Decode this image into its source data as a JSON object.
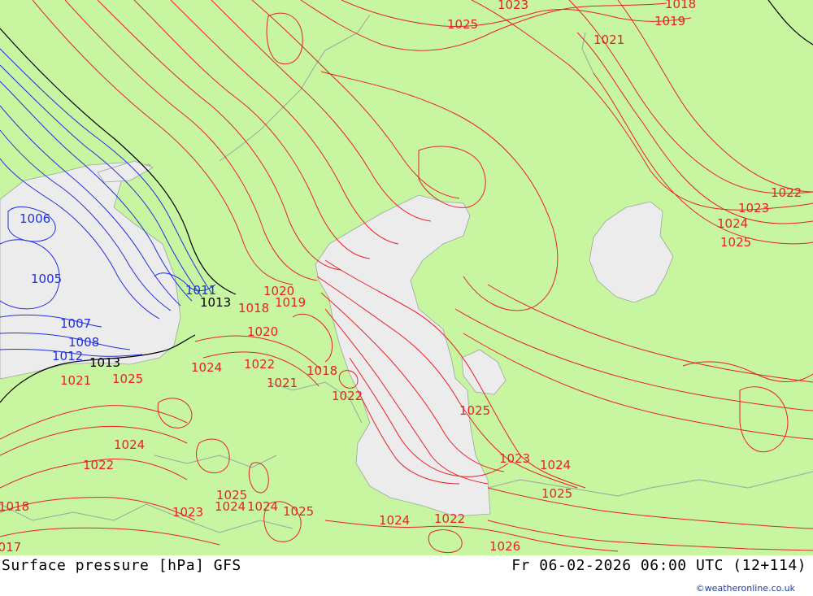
{
  "title": "Surface pressure [hPa] GFS",
  "valid_time": "Fr 06-02-2026 06:00 UTC (12+114)",
  "credit": "©weatheronline.co.uk",
  "colors": {
    "land": "#c8f5a0",
    "water": "#ececec",
    "high_isobar": "#e8202a",
    "low_isobar": "#2030e0",
    "ref_isobar": "#000000"
  },
  "isobar_labels": [
    {
      "text": "1023",
      "kind": "high"
    },
    {
      "text": "1018",
      "kind": "high"
    },
    {
      "text": "1019",
      "kind": "high"
    },
    {
      "text": "1025",
      "kind": "high"
    },
    {
      "text": "1021",
      "kind": "high"
    },
    {
      "text": "1022",
      "kind": "high"
    },
    {
      "text": "1023",
      "kind": "high"
    },
    {
      "text": "1024",
      "kind": "high"
    },
    {
      "text": "1025",
      "kind": "high"
    },
    {
      "text": "1006",
      "kind": "low"
    },
    {
      "text": "1005",
      "kind": "low"
    },
    {
      "text": "1007",
      "kind": "low"
    },
    {
      "text": "1008",
      "kind": "low"
    },
    {
      "text": "1012",
      "kind": "low"
    },
    {
      "text": "1013",
      "kind": "ref"
    },
    {
      "text": "1013",
      "kind": "ref"
    },
    {
      "text": "1011",
      "kind": "low"
    },
    {
      "text": "1020",
      "kind": "high"
    },
    {
      "text": "1019",
      "kind": "high"
    },
    {
      "text": "1018",
      "kind": "high"
    },
    {
      "text": "1020",
      "kind": "high"
    },
    {
      "text": "1022",
      "kind": "high"
    },
    {
      "text": "1024",
      "kind": "high"
    },
    {
      "text": "1021",
      "kind": "high"
    },
    {
      "text": "1018",
      "kind": "high"
    },
    {
      "text": "1022",
      "kind": "high"
    },
    {
      "text": "1025",
      "kind": "high"
    },
    {
      "text": "1021",
      "kind": "high"
    },
    {
      "text": "1025",
      "kind": "high"
    },
    {
      "text": "1024",
      "kind": "high"
    },
    {
      "text": "1022",
      "kind": "high"
    },
    {
      "text": "1023",
      "kind": "high"
    },
    {
      "text": "1025",
      "kind": "high"
    },
    {
      "text": "1024",
      "kind": "high"
    },
    {
      "text": "1024",
      "kind": "high"
    },
    {
      "text": "1025",
      "kind": "high"
    },
    {
      "text": "1024",
      "kind": "high"
    },
    {
      "text": "1022",
      "kind": "high"
    },
    {
      "text": "1023",
      "kind": "high"
    },
    {
      "text": "1024",
      "kind": "high"
    },
    {
      "text": "1025",
      "kind": "high"
    },
    {
      "text": "1026",
      "kind": "high"
    },
    {
      "text": "1018",
      "kind": "high"
    },
    {
      "text": "1017",
      "kind": "high"
    }
  ]
}
